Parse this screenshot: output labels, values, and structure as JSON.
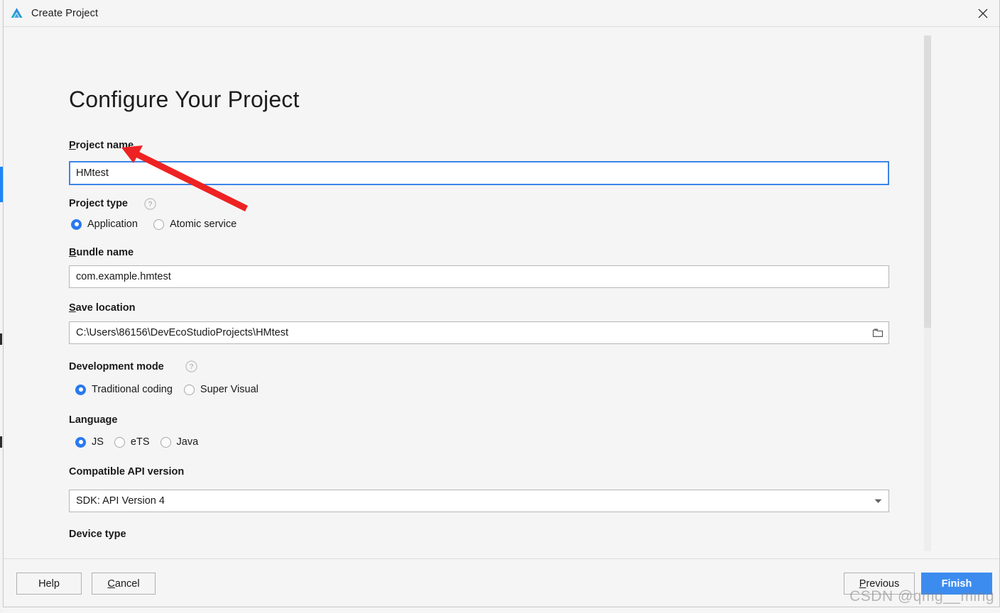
{
  "window": {
    "title": "Create Project",
    "logo_icon": "deveco-triangle-logo",
    "close_icon": "close-icon"
  },
  "page": {
    "heading": "Configure Your Project"
  },
  "fields": {
    "project_name": {
      "label_mnemonic": "P",
      "label_rest": "roject name",
      "value": "HMtest",
      "focused": true
    },
    "project_type": {
      "label": "Project type",
      "help_icon": "help-question-icon",
      "options": [
        {
          "label": "Application",
          "checked": true
        },
        {
          "label": "Atomic service",
          "checked": false
        }
      ]
    },
    "bundle_name": {
      "label_mnemonic": "B",
      "label_rest": "undle name",
      "value": "com.example.hmtest"
    },
    "save_location": {
      "label_mnemonic": "S",
      "label_rest": "ave location",
      "value": "C:\\Users\\86156\\DevEcoStudioProjects\\HMtest",
      "browse_icon": "folder-icon"
    },
    "development_mode": {
      "label": "Development mode",
      "help_icon": "help-question-icon",
      "options": [
        {
          "label": "Traditional coding",
          "checked": true
        },
        {
          "label": "Super Visual",
          "checked": false
        }
      ]
    },
    "language": {
      "label": "Language",
      "options": [
        {
          "label": "JS",
          "checked": true
        },
        {
          "label": "eTS",
          "checked": false
        },
        {
          "label": "Java",
          "checked": false
        }
      ]
    },
    "compatible_api_version": {
      "label": "Compatible API version",
      "value": "SDK: API Version 4",
      "arrow_icon": "chevron-down-icon"
    },
    "device_type": {
      "label": "Device type"
    }
  },
  "footer": {
    "help": {
      "mnemonic": "",
      "text": "Help"
    },
    "cancel": {
      "mnemonic": "C",
      "rest": "ancel"
    },
    "previous": {
      "mnemonic": "P",
      "rest": "revious"
    },
    "finish": {
      "text": "Finish"
    }
  },
  "annotation": {
    "type": "red-arrow",
    "color": "#ee2222",
    "points_to": "project-name-input"
  },
  "watermark": {
    "text": "CSDN @qmg__ming"
  },
  "colors": {
    "accent": "#3c8cf0",
    "focus_border": "#3c85e8",
    "radio_checked": "#2979ef",
    "window_bg": "#f5f5f5",
    "input_bg": "#ffffff",
    "annotation_red": "#ee2222"
  }
}
